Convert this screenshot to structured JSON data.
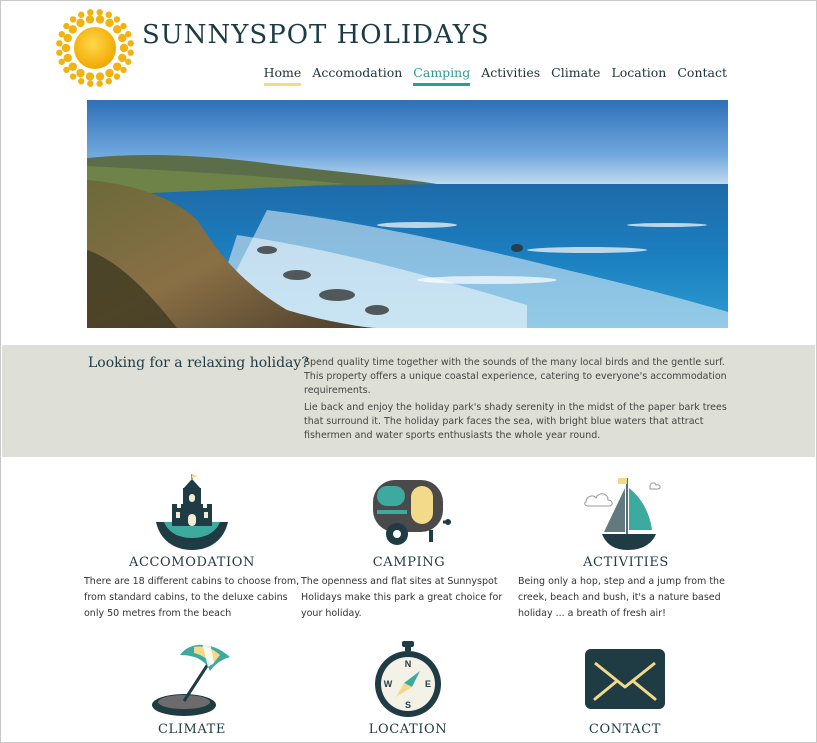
{
  "site": {
    "title": "SUNNYSPOT HOLIDAYS"
  },
  "nav": {
    "home": "Home",
    "accomodation": "Accomodation",
    "camping": "Camping",
    "activities": "Activities",
    "climate": "Climate",
    "location": "Location",
    "contact": "Contact"
  },
  "intro": {
    "heading": "Looking for a relaxing holiday?",
    "paragraph1": "Spend quality time together with the sounds of the many local birds and the gentle surf. This property offers a unique coastal experience, catering to everyone's accommodation requirements.",
    "paragraph2": "Lie back and enjoy the holiday park's shady serenity in the midst of the paper bark trees that surround it. The holiday park faces the sea, with bright blue waters that attract fishermen and water sports enthusiasts the whole year round."
  },
  "cards": {
    "accomodation": {
      "title": "ACCOMODATION",
      "text": "There are 18 different cabins to choose from, from standard cabins, to the deluxe cabins only 50 metres from the beach",
      "icon": "castle-icon"
    },
    "camping": {
      "title": "CAMPING",
      "text": "The openness and flat sites at Sunnyspot Holidays make this park a great choice for your holiday.",
      "icon": "caravan-icon"
    },
    "activities": {
      "title": "ACTIVITIES",
      "text": "Being only a hop, step and a jump from the creek, beach and bush, it's a nature based holiday ... a breath of fresh air!",
      "icon": "sailboat-icon"
    },
    "climate": {
      "title": "CLIMATE",
      "icon": "beach-umbrella-icon"
    },
    "location": {
      "title": "LOCATION",
      "icon": "compass-icon",
      "compass": {
        "n": "N",
        "s": "S",
        "e": "E",
        "w": "W"
      }
    },
    "contact": {
      "title": "CONTACT",
      "icon": "envelope-icon"
    }
  },
  "colors": {
    "primary": "#1f3b44",
    "teal": "#2e9c95",
    "sun": "#f2b90f",
    "cream": "#f3d98a",
    "band": "#dedfd6"
  }
}
